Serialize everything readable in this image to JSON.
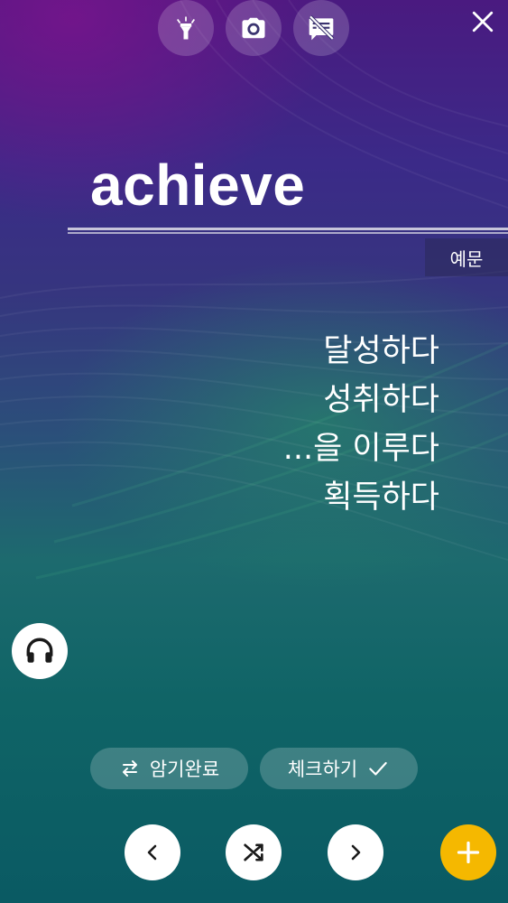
{
  "toolbar": {
    "flashlight_icon": "flashlight-icon",
    "camera_icon": "camera-icon",
    "subtitles_off_icon": "subtitles-off-icon",
    "close_icon": "close-icon"
  },
  "card": {
    "word": "achieve",
    "example_tab_label": "예문",
    "meanings": [
      "달성하다",
      "성취하다",
      "...을 이루다",
      "획득하다"
    ]
  },
  "actions": {
    "memorized_label": "암기완료",
    "check_label": "체크하기"
  },
  "colors": {
    "accent_fab": "#f5b800",
    "icon_dark": "#1a1a1a"
  }
}
